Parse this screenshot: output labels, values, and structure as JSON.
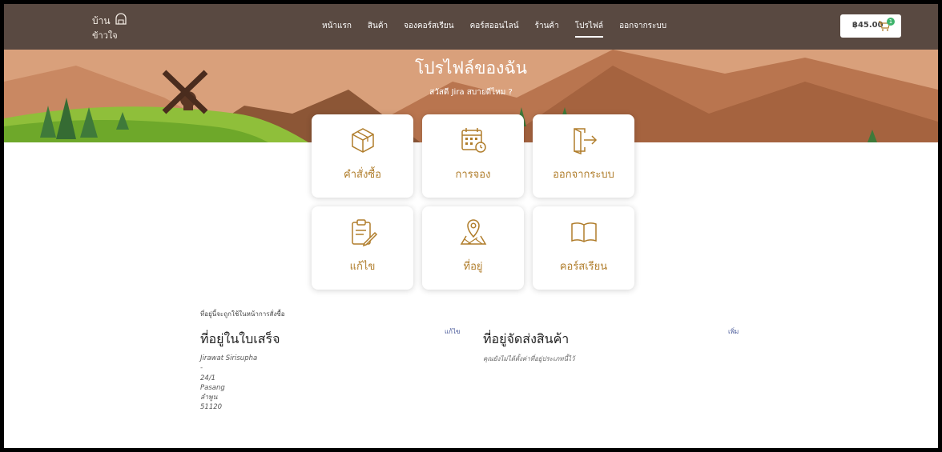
{
  "nav": {
    "logo_line1": "บ้าน",
    "logo_line2": "ข้าวใจ",
    "menu": [
      {
        "label": "หน้าแรก"
      },
      {
        "label": "สินค้า"
      },
      {
        "label": "จองคอร์สเรียน"
      },
      {
        "label": "คอร์สออนไลน์"
      },
      {
        "label": "ร้านค้า"
      },
      {
        "label": "โปรไฟล์",
        "active": true
      },
      {
        "label": "ออกจากระบบ"
      }
    ],
    "cart_total": "฿45.00",
    "cart_count": "1"
  },
  "banner": {
    "title": "โปรไฟล์ของฉัน",
    "greeting": "สวัสดี Jira สบายดีไหม ?"
  },
  "tiles": [
    {
      "label": "คำสั่งซื้อ",
      "icon": "package-box-icon"
    },
    {
      "label": "การจอง",
      "icon": "calendar-clock-icon"
    },
    {
      "label": "ออกจากระบบ",
      "icon": "logout-door-icon"
    },
    {
      "label": "แก้ไข",
      "icon": "clipboard-edit-icon"
    },
    {
      "label": "ที่อยู่",
      "icon": "map-pin-icon"
    },
    {
      "label": "คอร์สเรียน",
      "icon": "open-book-icon"
    }
  ],
  "addresses": {
    "note": "ที่อยู่นี้จะถูกใช้ในหน้าการสั่งซื้อ",
    "billing": {
      "title": "ที่อยู่ในใบเสร็จ",
      "edit_label": "แก้ไข",
      "lines": [
        "Jirawat Sirisupha",
        "-",
        "24/1",
        "Pasang",
        "ลำพูน",
        "51120"
      ]
    },
    "shipping": {
      "title": "ที่อยู่จัดส่งสินค้า",
      "add_label": "เพิ่ม",
      "empty_text": "คุณยังไม่ได้ตั้งค่าที่อยู่ประเภทนี้ไว้"
    }
  },
  "colors": {
    "nav_bg": "#594941",
    "accent": "#b07d2b",
    "link": "#4a5a9a",
    "banner_sky": "#d9a07b"
  }
}
